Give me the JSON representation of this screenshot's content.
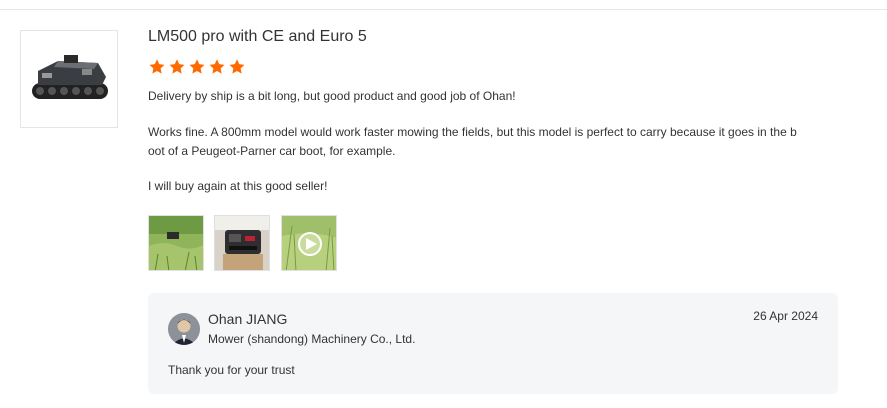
{
  "review": {
    "title": "LM500 pro with CE and Euro 5",
    "rating": 5,
    "star_color": "#ff6a00",
    "lines": [
      "Delivery by ship is a bit long, but good product and good job of Ohan!",
      "Works fine. A 800mm model would work faster mowing the fields, but this model is perfect to carry because it goes in the b",
      "oot of a Peugeot-Parner car boot, for example.",
      "I will buy again at this good seller!"
    ],
    "media": [
      {
        "icon": "photo-grass-mower"
      },
      {
        "icon": "photo-mower-in-car"
      },
      {
        "icon": "video-mowing-field",
        "video": true
      }
    ]
  },
  "reply": {
    "seller_name": "Ohan JIANG",
    "company": "Mower (shandong) Machinery Co., Ltd.",
    "date": "26 Apr 2024",
    "text": "Thank you for your trust"
  }
}
